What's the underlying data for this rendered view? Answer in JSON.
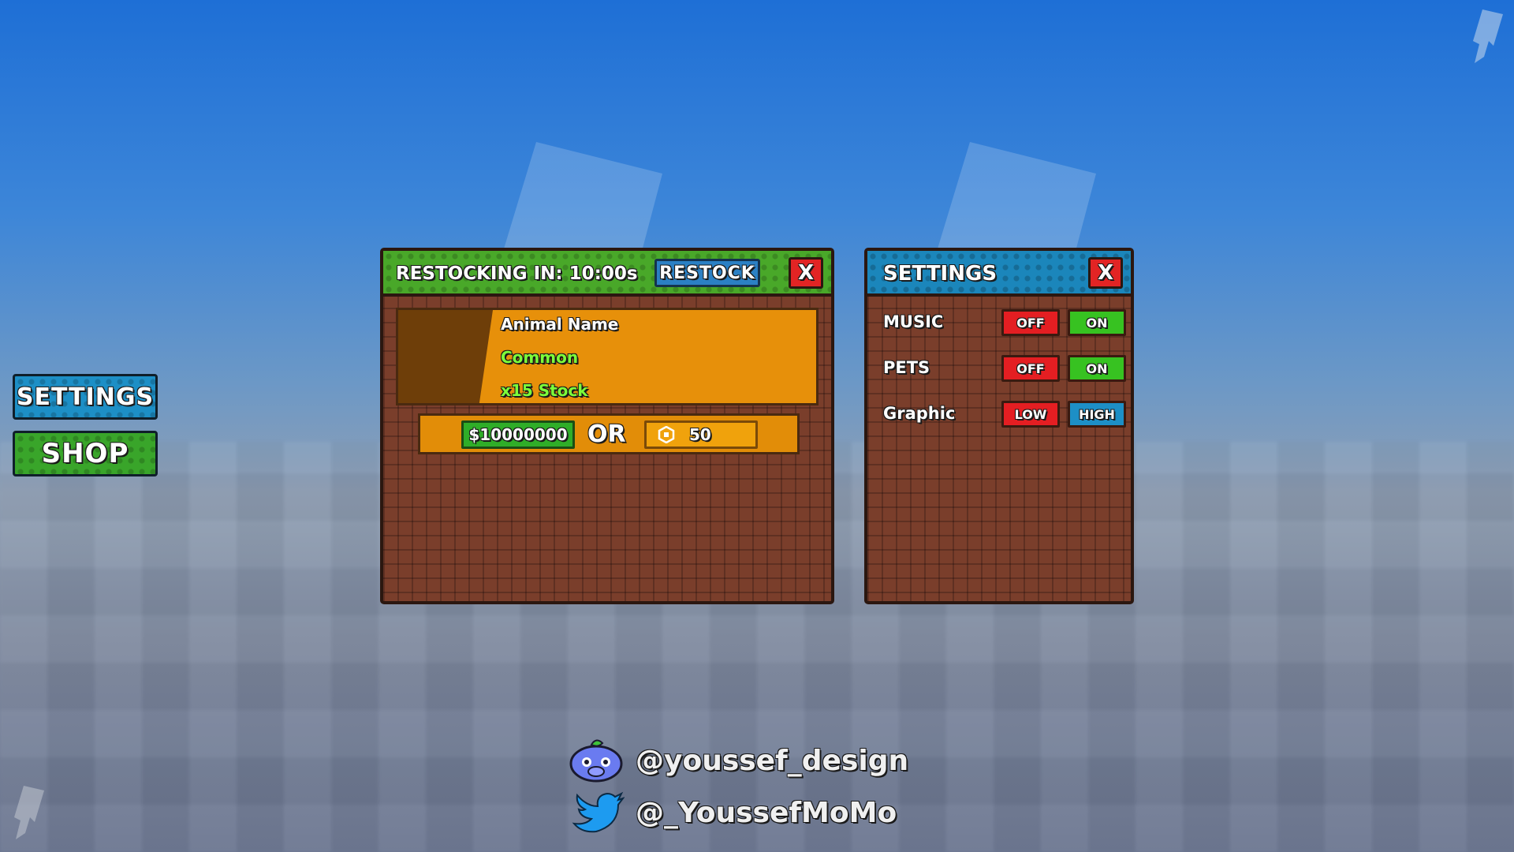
{
  "side_menu": {
    "settings_label": "SETTINGS",
    "shop_label": "SHOP"
  },
  "shop": {
    "restock_text": "RESTOCKING IN: 10:00s",
    "restock_button": "RESTOCK",
    "close": "X",
    "item": {
      "name": "Animal Name",
      "rarity": "Common",
      "stock": "x15 Stock"
    },
    "price": {
      "cash": "$10000000",
      "or": "OR",
      "robux": "50"
    }
  },
  "settings": {
    "title": "SETTINGS",
    "close": "X",
    "rows": [
      {
        "label": "MUSIC",
        "left": "OFF",
        "right": "ON"
      },
      {
        "label": "PETS",
        "left": "OFF",
        "right": "ON"
      },
      {
        "label": "Graphic",
        "left": "LOW",
        "right": "HIGH"
      }
    ]
  },
  "social": {
    "discord": "@youssef_design",
    "twitter": "@_YoussefMoMo"
  },
  "colors": {
    "accent_green": "#49a829",
    "accent_blue": "#1b86bb",
    "panel_brown": "#7a3e2b",
    "rarity_green": "#7dff3a",
    "close_red": "#e22424"
  }
}
